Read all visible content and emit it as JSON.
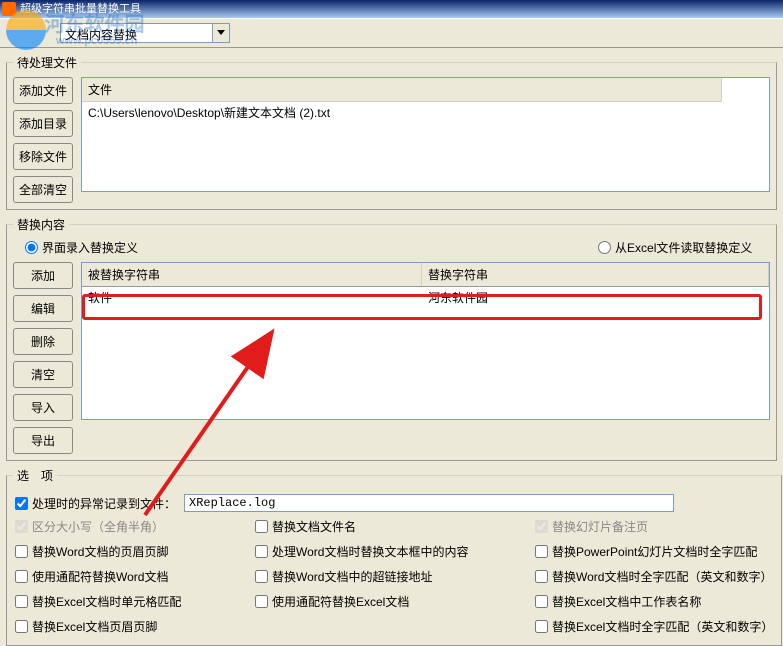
{
  "title": "超级字符串批量替换工具",
  "watermark": {
    "name": "河东软件园",
    "url": "www.pc0359.cn"
  },
  "toolbar": {
    "mode_label": "文档内容替换"
  },
  "files": {
    "legend": "待处理文件",
    "header": "文件",
    "rows": [
      "C:\\Users\\lenovo\\Desktop\\新建文本文档 (2).txt"
    ],
    "buttons": {
      "add_file": "添加文件",
      "add_dir": "添加目录",
      "remove": "移除文件",
      "clear": "全部清空"
    }
  },
  "replace": {
    "legend": "替换内容",
    "radio_ui": "界面录入替换定义",
    "radio_excel": "从Excel文件读取替换定义",
    "col_from": "被替换字符串",
    "col_to": "替换字符串",
    "rows": [
      {
        "from": "软件",
        "to": "河东软件园"
      }
    ],
    "buttons": {
      "add": "添加",
      "edit": "编辑",
      "del": "删除",
      "clear": "清空",
      "import": "导入",
      "export": "导出"
    }
  },
  "options": {
    "legend": "选　项",
    "log_label": "处理时的异常记录到文件：",
    "log_value": "XReplace.log",
    "checks": {
      "case": "区分大小写（全角半角）",
      "rename": "替换文档文件名",
      "ppt_notes": "替换幻灯片备注页",
      "word_hf": "替换Word文档的页眉页脚",
      "word_textbox": "处理Word文档时替换文本框中的内容",
      "ppt_whole": "替换PowerPoint幻灯片文档时全字匹配",
      "wildcard_word": "使用通配符替换Word文档",
      "word_hyperlink": "替换Word文档中的超链接地址",
      "word_whole": "替换Word文档时全字匹配（英文和数字）",
      "excel_cell": "替换Excel文档时单元格匹配",
      "wildcard_excel": "使用通配符替换Excel文档",
      "excel_sheet": "替换Excel文档中工作表名称",
      "excel_hf": "替换Excel文档页眉页脚",
      "excel_whole": "替换Excel文档时全字匹配（英文和数字）"
    }
  }
}
